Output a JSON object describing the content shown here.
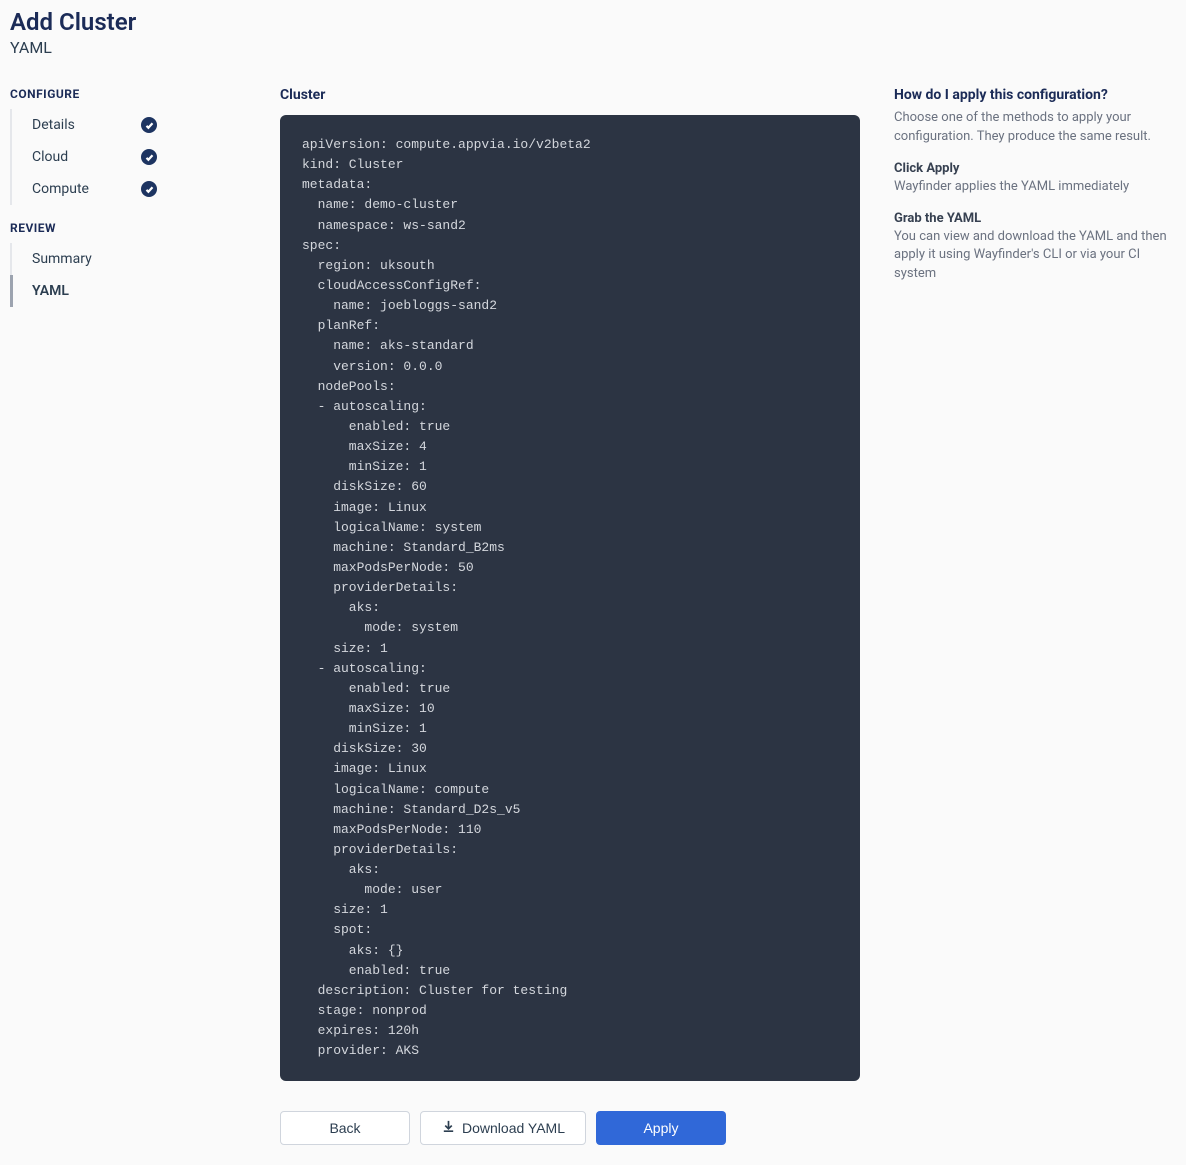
{
  "header": {
    "title": "Add Cluster",
    "subtitle": "YAML"
  },
  "sidebar": {
    "configure_label": "CONFIGURE",
    "review_label": "REVIEW",
    "configure_items": [
      {
        "label": "Details",
        "checked": true
      },
      {
        "label": "Cloud",
        "checked": true
      },
      {
        "label": "Compute",
        "checked": true
      }
    ],
    "review_items": [
      {
        "label": "Summary",
        "active": false
      },
      {
        "label": "YAML",
        "active": true
      }
    ]
  },
  "main": {
    "heading": "Cluster",
    "yaml": "apiVersion: compute.appvia.io/v2beta2\nkind: Cluster\nmetadata:\n  name: demo-cluster\n  namespace: ws-sand2\nspec:\n  region: uksouth\n  cloudAccessConfigRef:\n    name: joebloggs-sand2\n  planRef:\n    name: aks-standard\n    version: 0.0.0\n  nodePools:\n  - autoscaling:\n      enabled: true\n      maxSize: 4\n      minSize: 1\n    diskSize: 60\n    image: Linux\n    logicalName: system\n    machine: Standard_B2ms\n    maxPodsPerNode: 50\n    providerDetails:\n      aks:\n        mode: system\n    size: 1\n  - autoscaling:\n      enabled: true\n      maxSize: 10\n      minSize: 1\n    diskSize: 30\n    image: Linux\n    logicalName: compute\n    machine: Standard_D2s_v5\n    maxPodsPerNode: 110\n    providerDetails:\n      aks:\n        mode: user\n    size: 1\n    spot:\n      aks: {}\n      enabled: true\n  description: Cluster for testing\n  stage: nonprod\n  expires: 120h\n  provider: AKS"
  },
  "actions": {
    "back": "Back",
    "download": "Download YAML",
    "apply": "Apply"
  },
  "help": {
    "title": "How do I apply this configuration?",
    "intro": "Choose one of the methods to apply your configuration. They produce the same result.",
    "s1_title": "Click Apply",
    "s1_body": "Wayfinder applies the YAML immediately",
    "s2_title": "Grab the YAML",
    "s2_body": "You can view and download the YAML and then apply it using Wayfinder's CLI or via your CI system"
  }
}
